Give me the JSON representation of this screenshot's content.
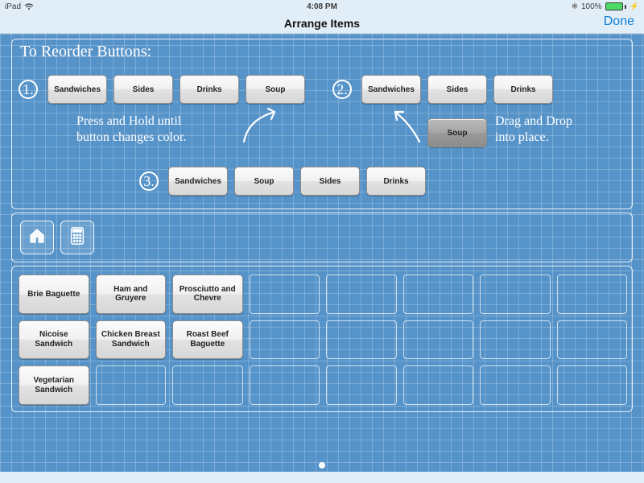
{
  "status": {
    "device": "iPad",
    "time": "4:08 PM",
    "battery_pct": "100%"
  },
  "nav": {
    "title": "Arrange Items",
    "done": "Done"
  },
  "instructions": {
    "heading": "To Reorder Buttons:",
    "step1_num": "1.",
    "step2_num": "2.",
    "step3_num": "3.",
    "hint1": "Press and Hold until\nbutton changes color.",
    "hint2": "Drag and Drop\ninto place.",
    "row1": [
      "Sandwiches",
      "Sides",
      "Drinks",
      "Soup"
    ],
    "row2": [
      "Sandwiches",
      "Sides",
      "Drinks"
    ],
    "row2_drag": "Soup",
    "row3": [
      "Sandwiches",
      "Soup",
      "Sides",
      "Drinks"
    ]
  },
  "grid": {
    "cols": 8,
    "rows": 3,
    "items": [
      "Brie Baguette",
      "Ham and Gruyere",
      "Prosciutto and Chevre",
      "Nicoise Sandwich",
      "Chicken Breast Sandwich",
      "Roast Beef Baguette",
      "Vegetarian Sandwich"
    ]
  }
}
